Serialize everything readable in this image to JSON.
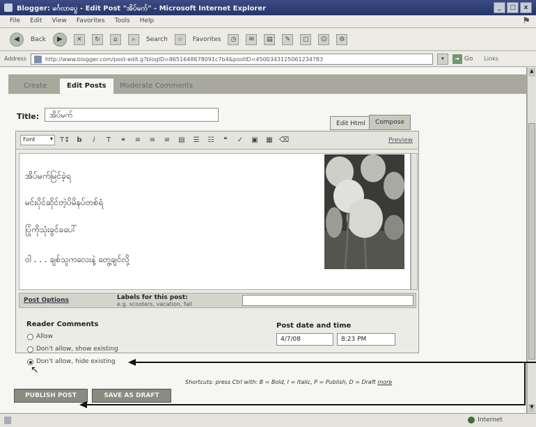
{
  "window": {
    "title": "Blogger: မင်္ဂလာပွေ - Edit Post \"အိပ်မက်\" - Microsoft Internet Explorer",
    "controls": [
      "_",
      "□",
      "x"
    ]
  },
  "menu": [
    "File",
    "Edit",
    "View",
    "Favorites",
    "Tools",
    "Help"
  ],
  "toolbar": {
    "back": "Back",
    "search": "Search",
    "favorites": "Favorites"
  },
  "address": {
    "label": "Address",
    "url": "http://www.blogger.com/post-edit.g?blogID=8651648678091c7b4&postID=4500343125061234783",
    "go": "Go",
    "links": "Links"
  },
  "page_tabs": [
    "Create",
    "Edit Posts",
    "Moderate Comments"
  ],
  "post": {
    "title_label": "Title:",
    "title_value": "အိပ်မက်",
    "mode_tabs": [
      "Edit Html",
      "Compose"
    ],
    "font_select": "Font",
    "preview": "Preview",
    "body_lines": [
      "အိပ်မက်မြင်ခဲ့ရ",
      "မင်းပိုင်ဆိုင်တဲ့ပိမိနပ်တစ်ရံ",
      "ပြုံကိုသုံးခွင်ခပေါ်",
      "ဝါ . . . ချစ်သူကလေးနဲ့ တွေ့ချင်လို့"
    ],
    "post_options": "Post Options",
    "labels_label": "Labels for this post:",
    "labels_example": "e.g. scooters, vacation, fall",
    "labels_value": ""
  },
  "reader_comments": {
    "title": "Reader Comments",
    "options": [
      "Allow",
      "Don't allow, show existing",
      "Don't allow, hide existing"
    ],
    "selected_index": 2
  },
  "post_date": {
    "title": "Post date and time",
    "date": "4/7/08",
    "time": "8:23 PM"
  },
  "shortcuts": {
    "text": "Shortcuts: press Ctrl with: B = Bold, I = Italic, P = Publish, D = Draft",
    "more": "more"
  },
  "buttons": {
    "publish": "PUBLISH POST",
    "draft": "SAVE AS DRAFT"
  },
  "status": {
    "zone": "Internet"
  },
  "colors": {
    "tab_band": "#a8a89c",
    "button": "#8a8a80",
    "titlebar": "#26356a"
  }
}
